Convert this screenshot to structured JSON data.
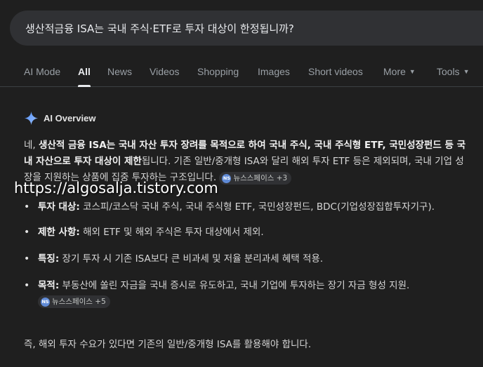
{
  "search": {
    "query": "생산적금융 ISA는 국내 주식·ETF로 투자 대상이 한정됩니까?"
  },
  "tabs": [
    {
      "label": "AI Mode"
    },
    {
      "label": "All"
    },
    {
      "label": "News"
    },
    {
      "label": "Videos"
    },
    {
      "label": "Shopping"
    },
    {
      "label": "Images"
    },
    {
      "label": "Short videos"
    },
    {
      "label": "More"
    },
    {
      "label": "Tools"
    }
  ],
  "overview": {
    "title": "AI Overview",
    "intro": {
      "t1": "네, ",
      "b1": "생산적 금융 ISA는 국내 자산 투자 장려를 목적으로 하여 국내 주식, 국내 주식형 ETF, 국민성장펀드 등 국내 자산으로 투자 대상이 제한",
      "t2": "됩니다. 기존 일반/중개형 ISA와 달리 해외 투자 ETF 등은 제외되며, 국내 기업 성장을 지원하는 상품에 집중 투자하는 구조입니다.",
      "chip": "뉴스스페이스 +3"
    },
    "bullets": [
      {
        "label": "투자 대상:",
        "text": " 코스피/코스닥 국내 주식, 국내 주식형 ETF, 국민성장펀드, BDC(기업성장집합투자기구)."
      },
      {
        "label": "제한 사항:",
        "text": " 해외 ETF 및 해외 주식은 투자 대상에서 제외."
      },
      {
        "label": "특징:",
        "text": " 장기 투자 시 기존 ISA보다 큰 비과세 및 저율 분리과세 혜택 적용."
      },
      {
        "label": "목적:",
        "text": " 부동산에 쏠린 자금을 국내 증시로 유도하고, 국내 기업에 투자하는 장기 자금 형성 지원.",
        "chip": "뉴스스페이스 +5"
      }
    ],
    "conclusion": "즉, 해외 투자 수요가 있다면 기존의 일반/중개형 ISA를 활용해야 합니다."
  },
  "chip_icon": "NS",
  "watermark": "https://algosalja.tistory.com",
  "colors": {
    "background": "#1f1f1f",
    "search_box": "#303134",
    "accent_sparkle": "#8ab4f8"
  }
}
